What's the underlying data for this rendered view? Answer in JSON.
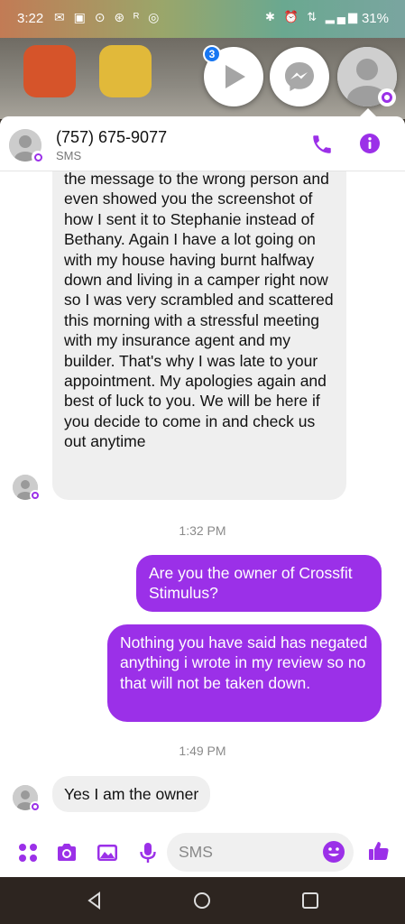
{
  "status_bar": {
    "time": "3:22",
    "left_icons": "✉ ▣ ⊙ ⊛ ᴿ ◎",
    "right_icons": "✱ ⏰ ⇅ ▂▄▆",
    "battery": "31%"
  },
  "chat_heads": {
    "badge": "3"
  },
  "header": {
    "contact_name": "(757) 675-9077",
    "subtitle": "SMS"
  },
  "messages": {
    "long_incoming": "the message to the wrong person and even showed you the screenshot of how I sent it to Stephanie instead of Bethany. Again I have a lot going on with my house having burnt halfway down and living in a camper right now so I was very scrambled and scattered this morning with a stressful meeting with my insurance agent and my builder. That's why I was late to your appointment. My apologies again and best of luck to you. We will be here if you decide to come in and check us out anytime",
    "time_1": "1:32 PM",
    "out_1": "Are you the owner of Crossfit Stimulus?",
    "out_2": "Nothing you have said has negated anything i wrote in my review so no that will not be taken down.",
    "time_2": "1:49 PM",
    "in_short": "Yes I am the owner"
  },
  "composer": {
    "placeholder": "SMS"
  },
  "colors": {
    "accent": "#9b30e8",
    "incoming_bubble": "#efefef",
    "messenger_blue": "#1877f2"
  }
}
